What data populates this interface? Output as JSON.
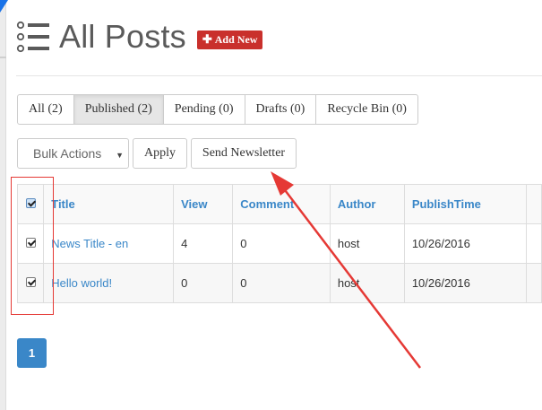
{
  "header": {
    "title": "All Posts",
    "add_new_label": "Add New",
    "add_new_icon": "plus-icon",
    "title_icon": "list-icon",
    "add_new_color": "#c9302c"
  },
  "filters": [
    {
      "label": "All (2)",
      "active": false
    },
    {
      "label": "Published (2)",
      "active": true
    },
    {
      "label": "Pending (0)",
      "active": false
    },
    {
      "label": "Drafts (0)",
      "active": false
    },
    {
      "label": "Recycle Bin (0)",
      "active": false
    }
  ],
  "actions": {
    "bulk_actions_selected": "Bulk Actions",
    "apply_label": "Apply",
    "send_newsletter_label": "Send Newsletter"
  },
  "table": {
    "columns": [
      "Title",
      "View",
      "Comment",
      "Author",
      "PublishTime"
    ],
    "header_checked": true,
    "rows": [
      {
        "checked": true,
        "title": "News Title - en",
        "view": "4",
        "comment": "0",
        "author": "host",
        "publish_time": "10/26/2016"
      },
      {
        "checked": true,
        "title": "Hello world!",
        "view": "0",
        "comment": "0",
        "author": "host",
        "publish_time": "10/26/2016"
      }
    ]
  },
  "pagination": {
    "current_page": "1",
    "active_color": "#3a87c8"
  },
  "annotation": {
    "color": "#e53935"
  }
}
